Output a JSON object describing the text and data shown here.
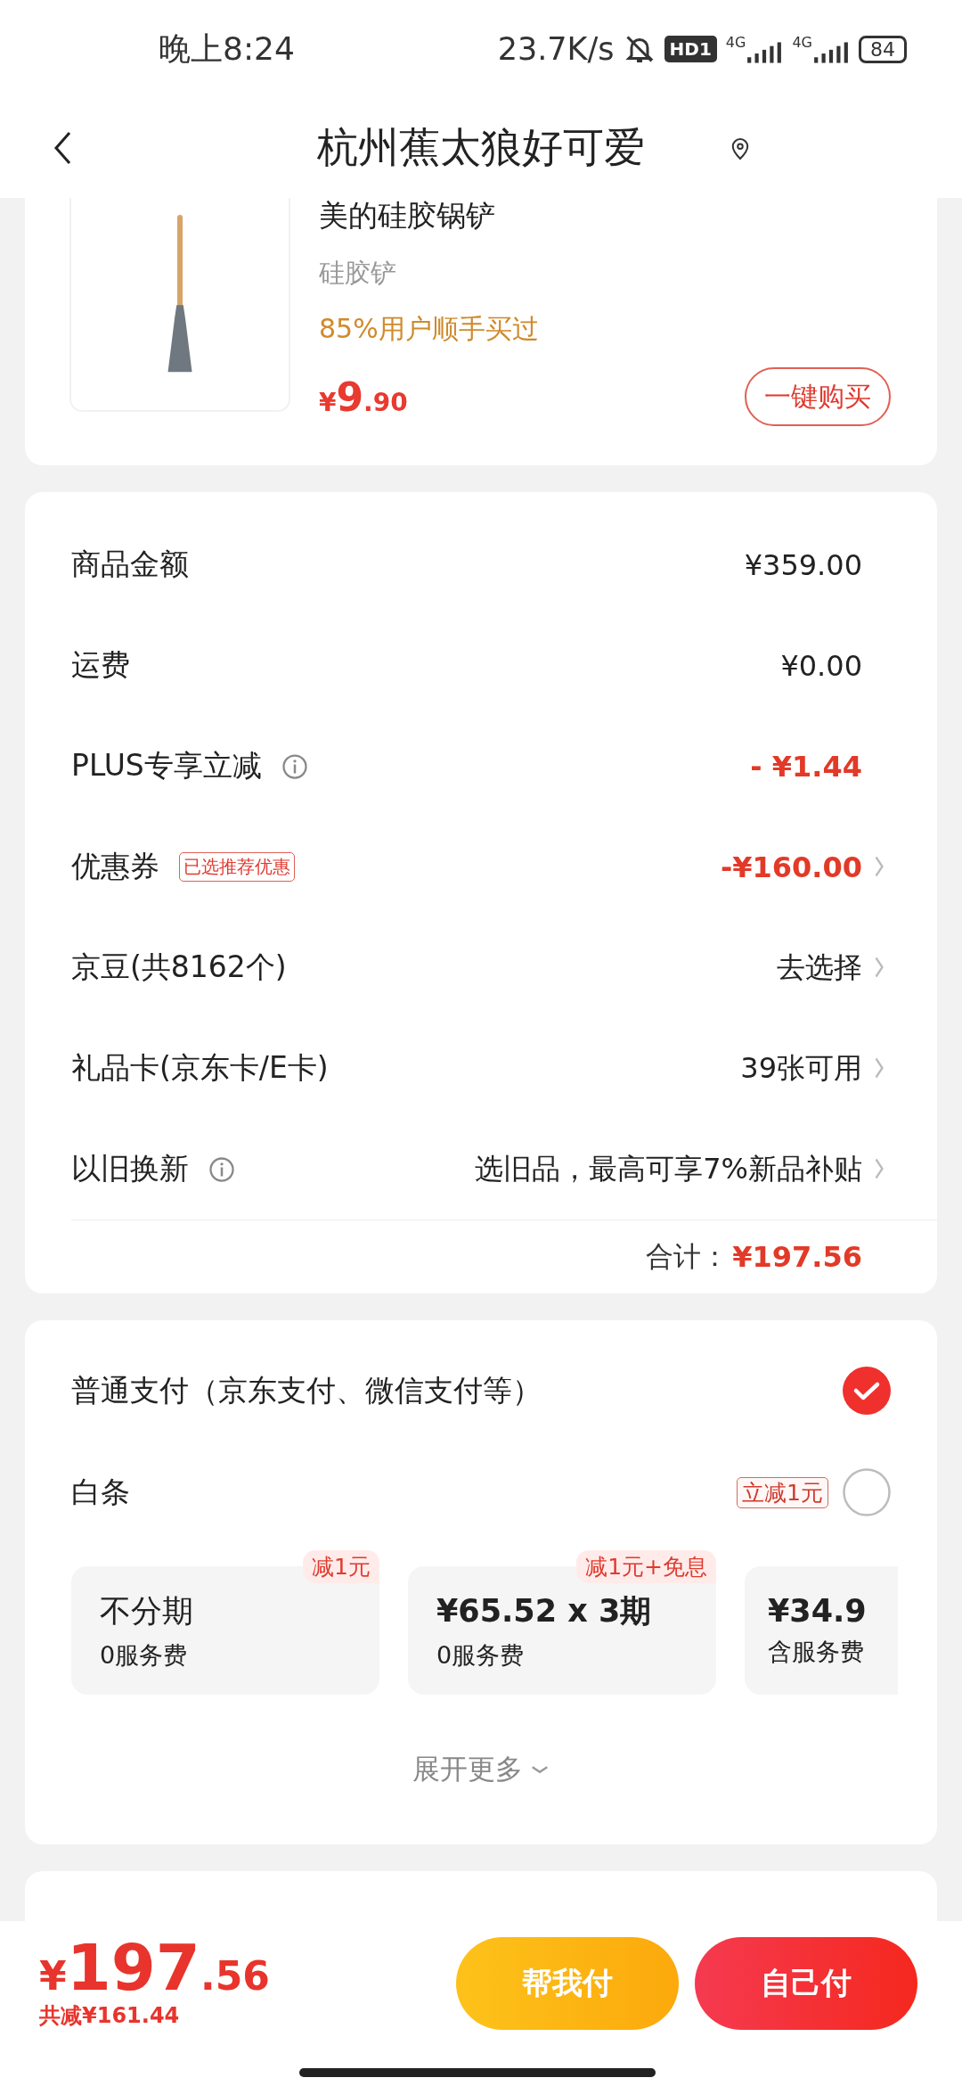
{
  "status_bar": {
    "time": "晚上8:24",
    "net_speed": "23.7K/s",
    "hd_badge": "HD1",
    "sim1_type": "4G",
    "sim2_type": "4G",
    "battery": "84"
  },
  "header": {
    "title": "杭州蕉太狼好可爱"
  },
  "recommended_product": {
    "name": "美的硅胶锅铲",
    "spec": "硅胶铲",
    "tag": "85%用户顺手买过",
    "currency": "¥",
    "price_int": "9",
    "price_dec": ".90",
    "buy_button": "一键购买"
  },
  "summary": {
    "rows": [
      {
        "label": "商品金额",
        "value": "¥359.00",
        "highlight": false,
        "info": false,
        "arrow": false
      },
      {
        "label": "运费",
        "value": "¥0.00",
        "highlight": false,
        "info": false,
        "arrow": false
      },
      {
        "label": "PLUS专享立减",
        "value": "- ¥1.44",
        "highlight": true,
        "info": true,
        "arrow": false
      },
      {
        "label": "优惠券",
        "badge": "已选推荐优惠",
        "value": "-¥160.00",
        "highlight": true,
        "info": false,
        "arrow": true
      },
      {
        "label": "京豆(共8162个)",
        "value": "去选择",
        "highlight": false,
        "info": false,
        "arrow": true
      },
      {
        "label": "礼品卡(京东卡/E卡)",
        "value": "39张可用",
        "highlight": false,
        "info": false,
        "arrow": true
      },
      {
        "label": "以旧换新",
        "value": "选旧品，最高可享7%新品补贴",
        "highlight": false,
        "info": true,
        "arrow": true
      }
    ],
    "total_label": "合计：",
    "total_value": "¥197.56"
  },
  "payment": {
    "options": [
      {
        "label": "普通支付（京东支付、微信支付等）",
        "selected": true
      },
      {
        "label": "白条",
        "badge": "立减1元",
        "selected": false
      }
    ],
    "plans": [
      {
        "title": "不分期",
        "fee": "0服务费",
        "tag": "减1元"
      },
      {
        "title": "¥65.52 x 3期",
        "fee": "0服务费",
        "tag": "减1元+免息"
      },
      {
        "title": "¥34.9",
        "fee": "含服务费"
      }
    ],
    "expand": "展开更多"
  },
  "bottom_bar": {
    "currency": "¥",
    "total_int": "197",
    "total_dec": ".56",
    "savings": "共减¥161.44",
    "buttons": [
      {
        "label": "帮我付",
        "kind": "secondary"
      },
      {
        "label": "自己付",
        "kind": "primary"
      }
    ]
  }
}
